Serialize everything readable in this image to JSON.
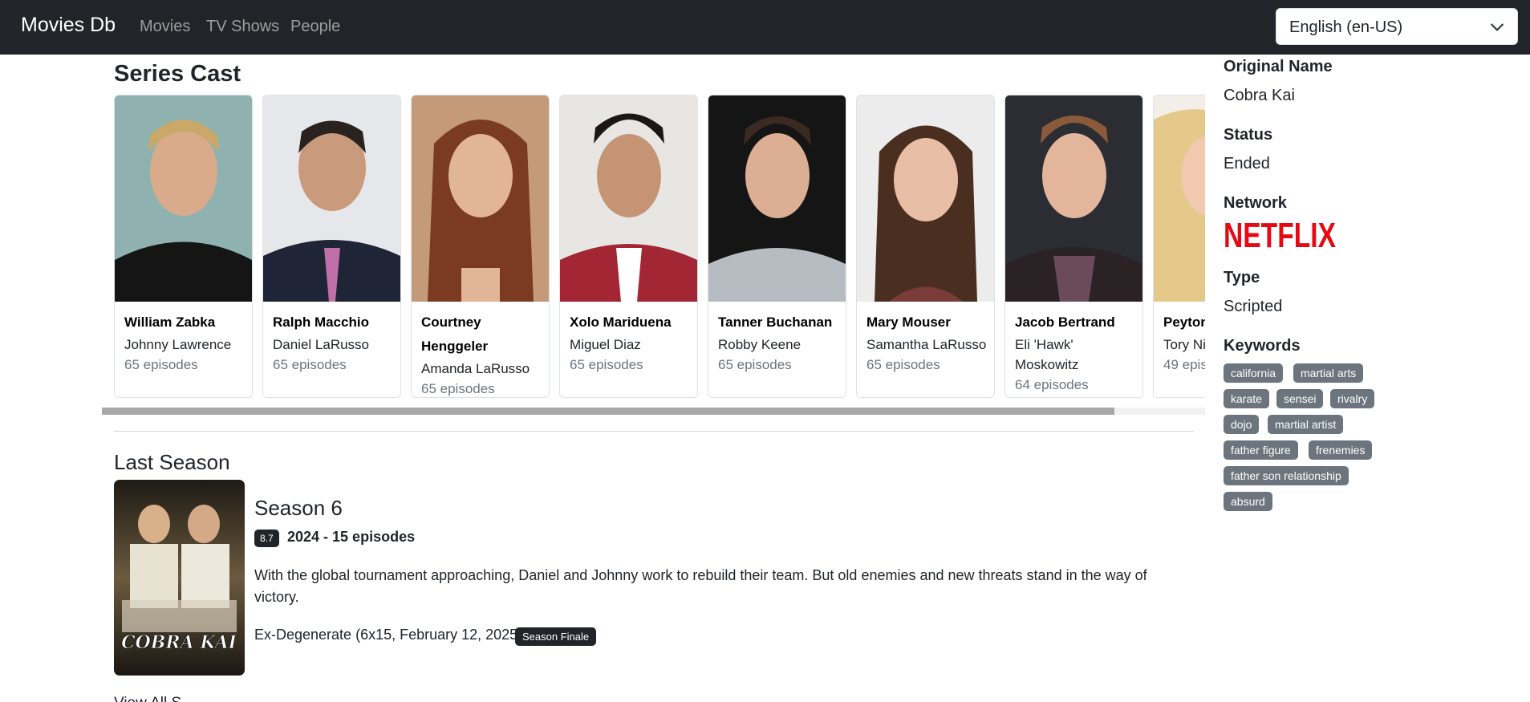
{
  "navbar": {
    "brand": "Movies Db",
    "links": [
      "Movies",
      "TV Shows",
      "People"
    ],
    "language": "English (en-US)"
  },
  "series_cast": {
    "heading": "Series Cast",
    "members": [
      {
        "name": "William Zabka",
        "character": "Johnny Lawrence",
        "episodes": "65 episodes"
      },
      {
        "name": "Ralph Macchio",
        "character": "Daniel LaRusso",
        "episodes": "65 episodes"
      },
      {
        "name": "Courtney Henggeler",
        "character": "Amanda LaRusso",
        "episodes": "65 episodes"
      },
      {
        "name": "Xolo Mariduena",
        "character": "Miguel Diaz",
        "episodes": "65 episodes"
      },
      {
        "name": "Tanner Buchanan",
        "character": "Robby Keene",
        "episodes": "65 episodes"
      },
      {
        "name": "Mary Mouser",
        "character": "Samantha LaRusso",
        "episodes": "65 episodes"
      },
      {
        "name": "Jacob Bertrand",
        "character": "Eli 'Hawk' Moskowitz",
        "episodes": "64 episodes"
      },
      {
        "name": "Peyton",
        "character": "Tory Ni",
        "episodes": "49 epis"
      }
    ],
    "scroll_progress": 0.918
  },
  "last_season": {
    "heading": "Last Season",
    "title": "Season 6",
    "rating": "8.7",
    "meta": "2024 - 15 episodes",
    "overview": "With the global tournament approaching, Daniel and Johnny work to rebuild their team. But old enemies and new threats stand in the way of victory.",
    "last_episode": "Ex-Degenerate (6x15, February 12, 2025)",
    "finale_badge": "Season Finale",
    "poster_logo": "COBRA KAI",
    "view_all": "View All S"
  },
  "sidebar": {
    "original_name_label": "Original Name",
    "original_name": "Cobra Kai",
    "status_label": "Status",
    "status": "Ended",
    "network_label": "Network",
    "network_logo": "NETFLIX",
    "type_label": "Type",
    "type": "Scripted",
    "keywords_label": "Keywords",
    "keywords": [
      "california",
      "martial arts",
      "karate",
      "sensei",
      "rivalry",
      "dojo",
      "martial artist",
      "father figure",
      "frenemies",
      "father son relationship",
      "absurd"
    ]
  },
  "colors": {
    "navbar_bg": "#212529",
    "badge_dark": "#212529",
    "keyword_badge": "#6c757d",
    "netflix_red": "#e50914"
  }
}
